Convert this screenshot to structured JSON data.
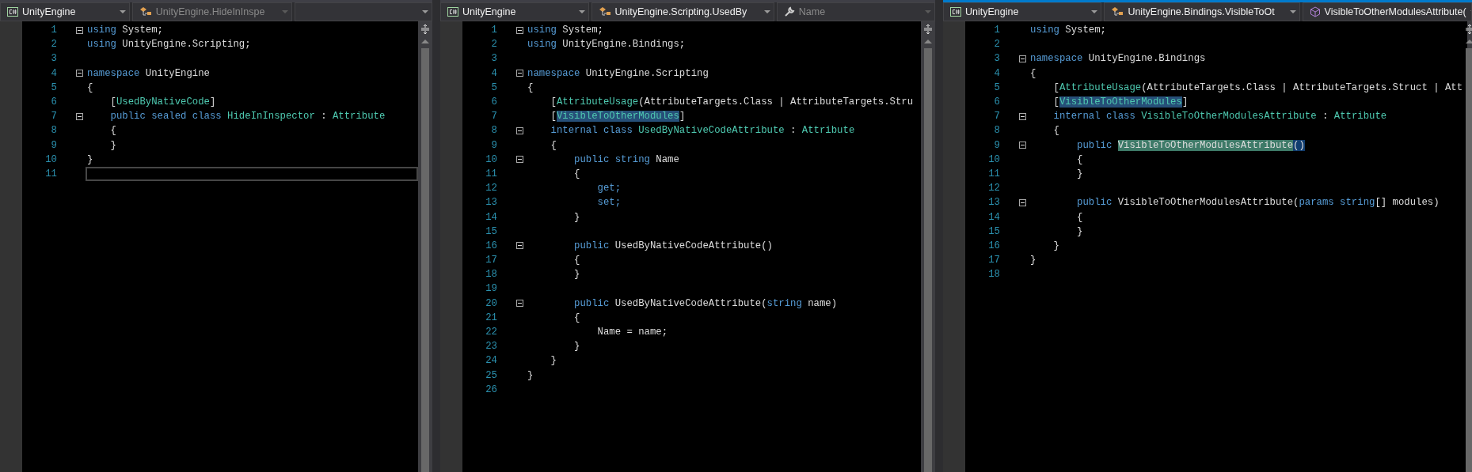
{
  "panes": [
    {
      "active": false,
      "dropdowns": [
        {
          "kind": "csharp",
          "label": "UnityEngine",
          "disabled": false
        },
        {
          "kind": "class",
          "label": "UnityEngine.HideInInspe",
          "disabled": true
        },
        {
          "kind": "empty",
          "disabled": false
        }
      ],
      "lines": [
        {
          "number": "1",
          "fold": true,
          "current": false,
          "tokens": [
            {
              "text": "using",
              "kind": "keyword"
            },
            {
              "text": " System;",
              "kind": "plain"
            }
          ]
        },
        {
          "number": "2",
          "fold": false,
          "current": false,
          "tokens": [
            {
              "text": "using",
              "kind": "keyword"
            },
            {
              "text": " UnityEngine.Scripting;",
              "kind": "plain"
            }
          ]
        },
        {
          "number": "3",
          "fold": false,
          "current": false
        },
        {
          "number": "4",
          "fold": true,
          "current": false,
          "tokens": [
            {
              "text": "namespace",
              "kind": "keyword"
            },
            {
              "text": " UnityEngine",
              "kind": "plain"
            }
          ]
        },
        {
          "number": "5",
          "fold": false,
          "current": false,
          "tokens": [
            {
              "text": "{",
              "kind": "plain"
            }
          ]
        },
        {
          "number": "6",
          "fold": false,
          "current": false,
          "tokens": [
            {
              "text": "    [",
              "kind": "plain"
            },
            {
              "text": "UsedByNativeCode",
              "kind": "type"
            },
            {
              "text": "]",
              "kind": "plain"
            }
          ]
        },
        {
          "number": "7",
          "fold": true,
          "current": false,
          "tokens": [
            {
              "text": "    public sealed class ",
              "kind": "keyword"
            },
            {
              "text": "HideInInspector",
              "kind": "type"
            },
            {
              "text": " : ",
              "kind": "plain"
            },
            {
              "text": "Attribute",
              "kind": "type"
            }
          ]
        },
        {
          "number": "8",
          "fold": false,
          "current": false,
          "tokens": [
            {
              "text": "    {",
              "kind": "plain"
            }
          ]
        },
        {
          "number": "9",
          "fold": false,
          "current": false,
          "tokens": [
            {
              "text": "    }",
              "kind": "plain"
            }
          ]
        },
        {
          "number": "10",
          "fold": false,
          "current": false,
          "tokens": [
            {
              "text": "}",
              "kind": "plain"
            }
          ]
        },
        {
          "number": "11",
          "fold": false,
          "current": true
        }
      ]
    },
    {
      "active": false,
      "dropdowns": [
        {
          "kind": "csharp",
          "label": "UnityEngine",
          "disabled": false
        },
        {
          "kind": "class",
          "label": "UnityEngine.Scripting.UsedBy",
          "disabled": false
        },
        {
          "kind": "wrench",
          "label": "Name",
          "disabled": true
        }
      ],
      "lines": [
        {
          "number": "1",
          "fold": true,
          "current": false,
          "tokens": [
            {
              "text": "using",
              "kind": "keyword"
            },
            {
              "text": " System;",
              "kind": "plain"
            }
          ]
        },
        {
          "number": "2",
          "fold": false,
          "current": false,
          "tokens": [
            {
              "text": "using",
              "kind": "keyword"
            },
            {
              "text": " UnityEngine.Bindings;",
              "kind": "plain"
            }
          ]
        },
        {
          "number": "3",
          "fold": false,
          "current": false
        },
        {
          "number": "4",
          "fold": true,
          "current": false,
          "tokens": [
            {
              "text": "namespace",
              "kind": "keyword"
            },
            {
              "text": " UnityEngine.Scripting",
              "kind": "plain"
            }
          ]
        },
        {
          "number": "5",
          "fold": false,
          "current": false,
          "tokens": [
            {
              "text": "{",
              "kind": "plain"
            }
          ]
        },
        {
          "number": "6",
          "fold": false,
          "current": false,
          "tokens": [
            {
              "text": "    [",
              "kind": "plain"
            },
            {
              "text": "AttributeUsage",
              "kind": "type"
            },
            {
              "text": "(AttributeTargets.Class | AttributeTargets.Stru",
              "kind": "plain"
            }
          ]
        },
        {
          "number": "7",
          "fold": false,
          "current": false,
          "tokens": [
            {
              "text": "    [",
              "kind": "plain"
            },
            {
              "text": "VisibleToOtherModules",
              "kind": "reference"
            },
            {
              "text": "]",
              "kind": "plain"
            }
          ]
        },
        {
          "number": "8",
          "fold": true,
          "current": false,
          "tokens": [
            {
              "text": "    internal class ",
              "kind": "keyword"
            },
            {
              "text": "UsedByNativeCodeAttribute",
              "kind": "type"
            },
            {
              "text": " : ",
              "kind": "plain"
            },
            {
              "text": "Attribute",
              "kind": "type"
            }
          ]
        },
        {
          "number": "9",
          "fold": false,
          "current": false,
          "tokens": [
            {
              "text": "    {",
              "kind": "plain"
            }
          ]
        },
        {
          "number": "10",
          "fold": true,
          "current": false,
          "tokens": [
            {
              "text": "        public string",
              "kind": "keyword"
            },
            {
              "text": " Name",
              "kind": "plain"
            }
          ]
        },
        {
          "number": "11",
          "fold": false,
          "current": false,
          "tokens": [
            {
              "text": "        {",
              "kind": "plain"
            }
          ]
        },
        {
          "number": "12",
          "fold": false,
          "current": false,
          "tokens": [
            {
              "text": "            get;",
              "kind": "keyword"
            }
          ]
        },
        {
          "number": "13",
          "fold": false,
          "current": false,
          "tokens": [
            {
              "text": "            set;",
              "kind": "keyword"
            }
          ]
        },
        {
          "number": "14",
          "fold": false,
          "current": false,
          "tokens": [
            {
              "text": "        }",
              "kind": "plain"
            }
          ]
        },
        {
          "number": "15",
          "fold": false,
          "current": false
        },
        {
          "number": "16",
          "fold": true,
          "current": false,
          "tokens": [
            {
              "text": "        public",
              "kind": "keyword"
            },
            {
              "text": " UsedByNativeCodeAttribute()",
              "kind": "plain"
            }
          ]
        },
        {
          "number": "17",
          "fold": false,
          "current": false,
          "tokens": [
            {
              "text": "        {",
              "kind": "plain"
            }
          ]
        },
        {
          "number": "18",
          "fold": false,
          "current": false,
          "tokens": [
            {
              "text": "        }",
              "kind": "plain"
            }
          ]
        },
        {
          "number": "19",
          "fold": false,
          "current": false
        },
        {
          "number": "20",
          "fold": true,
          "current": false,
          "tokens": [
            {
              "text": "        public",
              "kind": "keyword"
            },
            {
              "text": " UsedByNativeCodeAttribute(",
              "kind": "plain"
            },
            {
              "text": "string",
              "kind": "keyword"
            },
            {
              "text": " name)",
              "kind": "plain"
            }
          ]
        },
        {
          "number": "21",
          "fold": false,
          "current": false,
          "tokens": [
            {
              "text": "        {",
              "kind": "plain"
            }
          ]
        },
        {
          "number": "22",
          "fold": false,
          "current": false,
          "tokens": [
            {
              "text": "            Name = name;",
              "kind": "plain"
            }
          ]
        },
        {
          "number": "23",
          "fold": false,
          "current": false,
          "tokens": [
            {
              "text": "        }",
              "kind": "plain"
            }
          ]
        },
        {
          "number": "24",
          "fold": false,
          "current": false,
          "tokens": [
            {
              "text": "    }",
              "kind": "plain"
            }
          ]
        },
        {
          "number": "25",
          "fold": false,
          "current": false,
          "tokens": [
            {
              "text": "}",
              "kind": "plain"
            }
          ]
        },
        {
          "number": "26",
          "fold": false,
          "current": false
        }
      ]
    },
    {
      "active": true,
      "dropdowns": [
        {
          "kind": "csharp",
          "label": "UnityEngine",
          "disabled": false
        },
        {
          "kind": "class",
          "label": "UnityEngine.Bindings.VisibleToOt",
          "disabled": false
        },
        {
          "kind": "method",
          "label": "VisibleToOtherModulesAttribute(",
          "disabled": false
        }
      ],
      "lines": [
        {
          "number": "1",
          "fold": false,
          "current": false,
          "tokens": [
            {
              "text": "using",
              "kind": "keyword"
            },
            {
              "text": " System;",
              "kind": "plain"
            }
          ]
        },
        {
          "number": "2",
          "fold": false,
          "current": false
        },
        {
          "number": "3",
          "fold": true,
          "current": false,
          "tokens": [
            {
              "text": "namespace",
              "kind": "keyword"
            },
            {
              "text": " UnityEngine.Bindings",
              "kind": "plain"
            }
          ]
        },
        {
          "number": "4",
          "fold": false,
          "current": false,
          "tokens": [
            {
              "text": "{",
              "kind": "plain"
            }
          ]
        },
        {
          "number": "5",
          "fold": false,
          "current": false,
          "tokens": [
            {
              "text": "    [",
              "kind": "plain"
            },
            {
              "text": "AttributeUsage",
              "kind": "type"
            },
            {
              "text": "(AttributeTargets.Class | AttributeTargets.Struct | Att",
              "kind": "plain"
            }
          ]
        },
        {
          "number": "6",
          "fold": false,
          "current": false,
          "tokens": [
            {
              "text": "    [",
              "kind": "plain"
            },
            {
              "text": "VisibleToOtherModules",
              "kind": "reference"
            },
            {
              "text": "]",
              "kind": "plain"
            }
          ]
        },
        {
          "number": "7",
          "fold": true,
          "current": false,
          "tokens": [
            {
              "text": "    internal class ",
              "kind": "keyword"
            },
            {
              "text": "VisibleToOtherModulesAttribute",
              "kind": "type"
            },
            {
              "text": " : ",
              "kind": "plain"
            },
            {
              "text": "Attribute",
              "kind": "type"
            }
          ]
        },
        {
          "number": "8",
          "fold": false,
          "current": false,
          "tokens": [
            {
              "text": "    {",
              "kind": "plain"
            }
          ]
        },
        {
          "number": "9",
          "fold": true,
          "current": false,
          "tokens": [
            {
              "text": "        public ",
              "kind": "keyword"
            },
            {
              "text": "VisibleToOtherModulesAttribute",
              "kind": "definition"
            },
            {
              "text": "()",
              "kind": "bracket-match"
            }
          ]
        },
        {
          "number": "10",
          "fold": false,
          "current": false,
          "tokens": [
            {
              "text": "        {",
              "kind": "plain"
            }
          ]
        },
        {
          "number": "11",
          "fold": false,
          "current": false,
          "tokens": [
            {
              "text": "        }",
              "kind": "plain"
            }
          ]
        },
        {
          "number": "12",
          "fold": false,
          "current": false
        },
        {
          "number": "13",
          "fold": true,
          "current": false,
          "tokens": [
            {
              "text": "        public",
              "kind": "keyword"
            },
            {
              "text": " VisibleToOtherModulesAttribute(",
              "kind": "plain"
            },
            {
              "text": "params string",
              "kind": "keyword"
            },
            {
              "text": "[] modules)",
              "kind": "plain"
            }
          ]
        },
        {
          "number": "14",
          "fold": false,
          "current": false,
          "tokens": [
            {
              "text": "        {",
              "kind": "plain"
            }
          ]
        },
        {
          "number": "15",
          "fold": false,
          "current": false,
          "tokens": [
            {
              "text": "        }",
              "kind": "plain"
            }
          ]
        },
        {
          "number": "16",
          "fold": false,
          "current": false,
          "tokens": [
            {
              "text": "    }",
              "kind": "plain"
            }
          ]
        },
        {
          "number": "17",
          "fold": false,
          "current": false,
          "tokens": [
            {
              "text": "}",
              "kind": "plain"
            }
          ]
        },
        {
          "number": "18",
          "fold": false,
          "current": false
        }
      ]
    }
  ]
}
